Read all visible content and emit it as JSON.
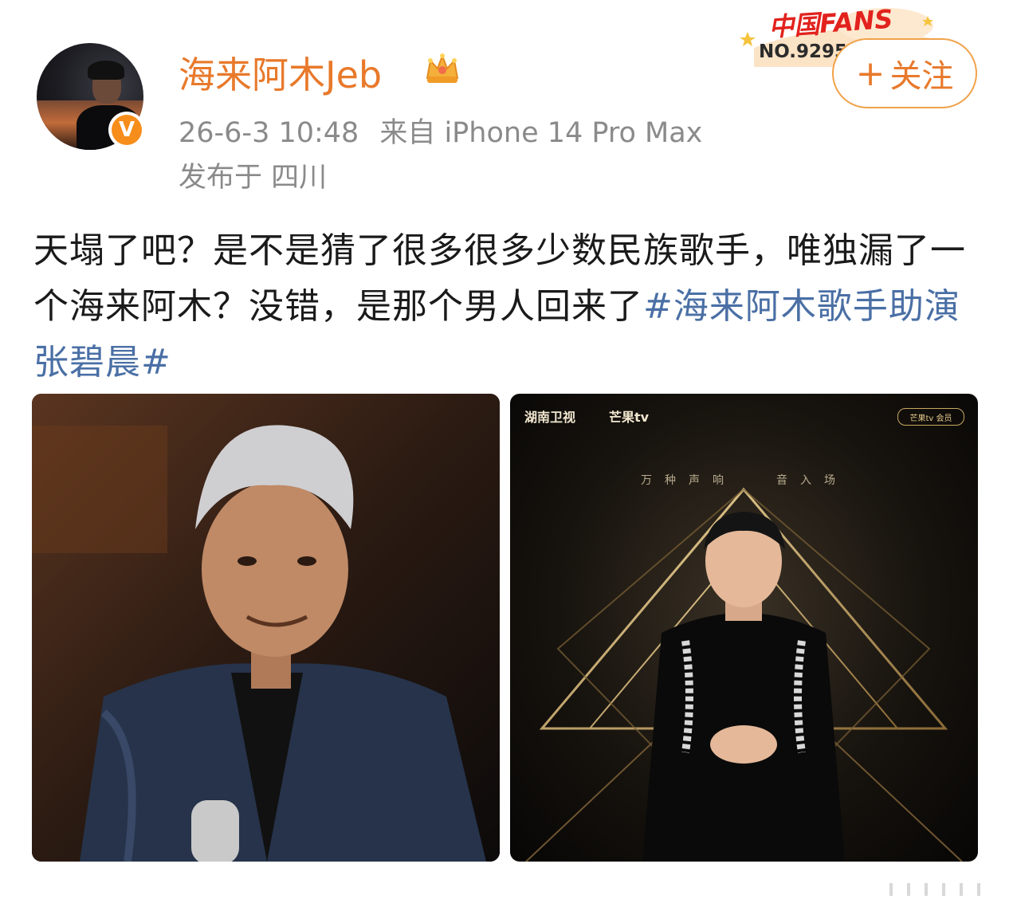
{
  "user": {
    "name": "海来阿木Jeb",
    "verified_badge": "V"
  },
  "post": {
    "time": "26-6-3 10:48",
    "source": "来自 iPhone 14 Pro Max",
    "location": "发布于 四川",
    "text_main": "天塌了吧？是不是猜了很多很多少数民族歌手，唯独漏了一个海来阿木？没错，是那个男人回来了",
    "hashtag": "#海来阿木歌手助演张碧晨#"
  },
  "fans_badge": {
    "title": "中国FANS",
    "number": "NO.9295"
  },
  "follow_button": {
    "plus": "+",
    "label": "关注"
  },
  "images": {
    "photo2_logo_left": "湖南卫视",
    "photo2_logo_right": "芒果tv",
    "photo2_corner": "芒果tv 会员",
    "photo2_caption_left": "万种声响",
    "photo2_caption_right": "音入场"
  },
  "colors": {
    "accent_orange": "#e8792b",
    "hashtag_blue": "#4a6fa5",
    "meta_gray": "#8a8a8a"
  }
}
